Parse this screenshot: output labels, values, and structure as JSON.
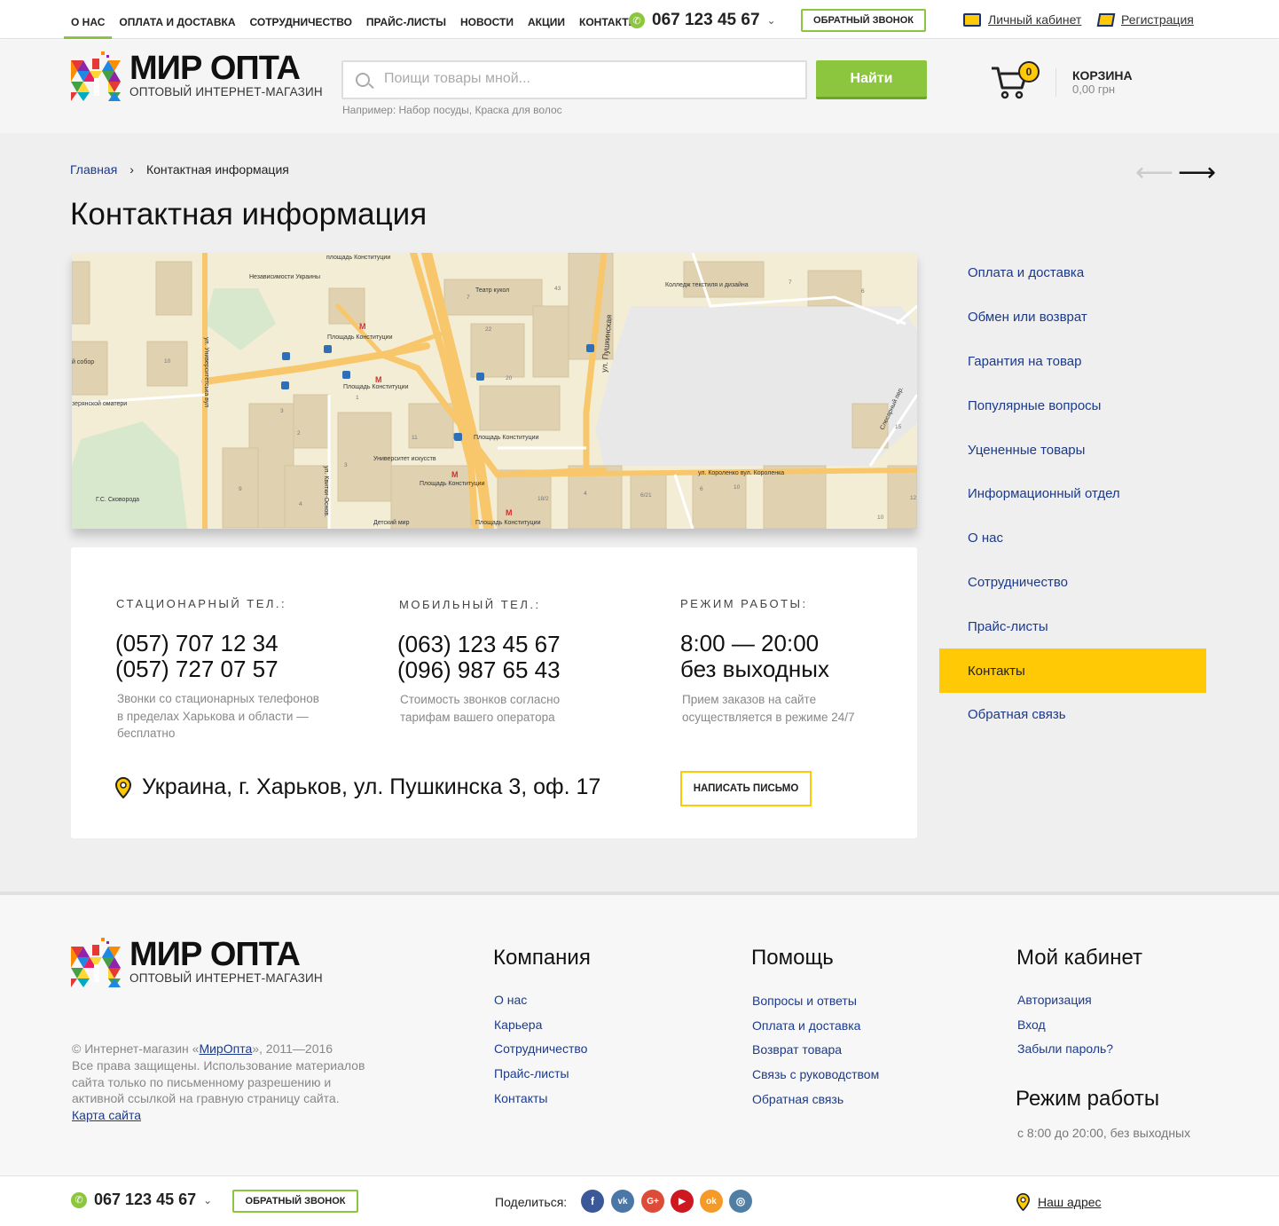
{
  "topnav": {
    "items": [
      "О НАС",
      "ОПЛАТА И ДОСТАВКА",
      "СОТРУДНИЧЕСТВО",
      "ПРАЙС-ЛИСТЫ",
      "НОВОСТИ",
      "АКЦИИ",
      "КОНТАКТЫ"
    ],
    "phone": "067 123 45 67",
    "callback": "ОБРАТНЫЙ ЗВОНОК",
    "account": "Личный кабинет",
    "register": "Регистрация"
  },
  "logo": {
    "title": "МИР ОПТА",
    "subtitle": "ОПТОВЫЙ ИНТЕРНЕТ-МАГАЗИН"
  },
  "search": {
    "placeholder": "Поищи товары мной...",
    "button": "Найти",
    "example_prefix": "Например:",
    "example_1": "Набор посуды",
    "example_2": "Краска для волос"
  },
  "cart": {
    "count": "0",
    "title": "КОРЗИНА",
    "sum": "0,00 грн"
  },
  "breadcrumb": {
    "home": "Главная",
    "sep": "›",
    "current": "Контактная информация"
  },
  "page_title": "Контактная информация",
  "map": {
    "labels": [
      "площадь Конституции",
      "Независимости Украины",
      "ул. Университетська вул",
      "Театр кукол",
      "ул. Пушкинская",
      "Колледж текстиля и дизайна",
      "Площадь Конституции",
      "Площадь Конституции",
      "Площадь Конституции",
      "Университет искусств",
      "Площадь Конституции",
      "Площадь Конституции",
      "ул. Квитки-Основ.",
      "Детский мир",
      "ул. Короленко вул. Короленка",
      "Слесарный пер.",
      "Г.С. Сковорода",
      "й собор",
      "зерянской оматери"
    ],
    "numbers": [
      "10",
      "3",
      "2",
      "9",
      "4",
      "11",
      "3",
      "22",
      "20",
      "43",
      "7",
      "6",
      "18/2",
      "4",
      "6/21",
      "6",
      "10",
      "15",
      "10",
      "12",
      "1",
      "7"
    ]
  },
  "contacts": {
    "landline": {
      "heading": "СТАЦИОНАРНЫЙ ТЕЛ.:",
      "line1": "(057) 707 12 34",
      "line2": "(057) 727 07 57",
      "note1": "Звонки со стационарных телефонов",
      "note2": "в пределах Харькова и области —",
      "note3": "бесплатно"
    },
    "mobile": {
      "heading": "МОБИЛЬНЫЙ ТЕЛ.:",
      "line1": "(063) 123 45 67",
      "line2": "(096) 987 65 43",
      "note1": "Стоимость звонков согласно",
      "note2": "тарифам вашего оператора"
    },
    "hours": {
      "heading": "РЕЖИМ РАБОТЫ:",
      "line1": "8:00 — 20:00",
      "line2": "без выходных",
      "note1": "Прием заказов на сайте",
      "note2": "осуществляется в режиме 24/7"
    },
    "address": "Украина, г. Харьков, ул. Пушкинска 3, оф. 17",
    "write_button": "НАПИСАТЬ ПИСЬМО"
  },
  "sidebar": {
    "items": [
      "Оплата и доставка",
      "Обмен или возврат",
      "Гарантия на товар",
      "Популярные вопросы",
      "Уцененные товары",
      "Информационный отдел",
      "О нас",
      "Сотрудничество",
      "Прайс-листы",
      "Контакты",
      "Обратная связь"
    ],
    "active_index": 9
  },
  "footer": {
    "copy_prefix": "© Интернет-магазин «",
    "copy_link": "МирОпта",
    "copy_suffix": "», 2011—2016",
    "rights": "Все права защищены. Использование материалов сайта только по письменному разрешению и активной ссылкой на гравную страницу сайта.",
    "sitemap": "Карта сайта",
    "company": {
      "heading": "Компания",
      "links": [
        "О нас",
        "Карьера",
        "Сотрудничество",
        "Прайс-листы",
        "Контакты"
      ]
    },
    "help": {
      "heading": "Помощь",
      "links": [
        "Вопросы и ответы",
        "Оплата и доставка",
        "Возврат товара",
        "Связь с руководством",
        "Обратная связь"
      ]
    },
    "cabinet": {
      "heading": "Мой кабинет",
      "links": [
        "Авторизация",
        "Вход",
        "Забыли пароль?"
      ]
    },
    "hours": {
      "heading": "Режим работы",
      "text": "с 8:00 до 20:00, без выходных"
    }
  },
  "bottombar": {
    "phone": "067 123 45 67",
    "callback": "ОБРАТНЫЙ ЗВОНОК",
    "share_label": "Поделиться:",
    "social": [
      {
        "name": "facebook-icon",
        "glyph": "f",
        "color": "#3b5998"
      },
      {
        "name": "vk-icon",
        "glyph": "vk",
        "color": "#4a76a8"
      },
      {
        "name": "google-plus-icon",
        "glyph": "G+",
        "color": "#dd4b39"
      },
      {
        "name": "youtube-icon",
        "glyph": "▶",
        "color": "#cc181e"
      },
      {
        "name": "odnoklassniki-icon",
        "glyph": "ok",
        "color": "#f59a28"
      },
      {
        "name": "instagram-icon",
        "glyph": "◎",
        "color": "#517fa4"
      }
    ],
    "our_address": "Наш адрес"
  },
  "colors": {
    "accent_green": "#8cc63f",
    "accent_yellow": "#ffc905",
    "link_blue": "#1b3a8c"
  }
}
